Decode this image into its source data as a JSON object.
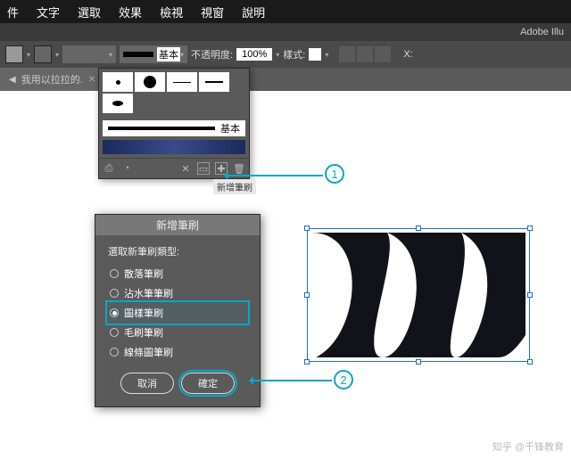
{
  "menubar": {
    "items": [
      "件",
      "文字",
      "選取",
      "效果",
      "檢視",
      "視窗",
      "說明"
    ]
  },
  "app": {
    "name": "Adobe Illu"
  },
  "toolbar": {
    "stroke_preset": "基本",
    "opacity_label": "不透明度:",
    "opacity_value": "100%",
    "style_label": "樣式:",
    "x_label": "X:"
  },
  "tabs": {
    "doc": {
      "label": "我用以拉拉的."
    }
  },
  "brushes_panel": {
    "basic_label": "基本",
    "tooltip": "新增筆刷"
  },
  "callouts": {
    "one": "1",
    "two": "2"
  },
  "dialog": {
    "title": "新增筆刷",
    "subtitle": "選取新筆刷類型:",
    "options": [
      "散落筆刷",
      "沾水筆筆刷",
      "圖樣筆刷",
      "毛刷筆刷",
      "線條圖筆刷"
    ],
    "selected_index": 2,
    "cancel": "取消",
    "confirm": "確定"
  },
  "watermark": "知乎 @千锋教育"
}
